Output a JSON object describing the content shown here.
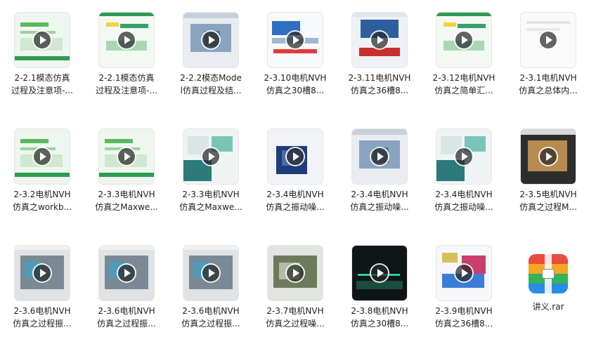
{
  "files": [
    {
      "line1": "2-2.1模态仿真",
      "line2": "过程及注意项-...",
      "theme": "green"
    },
    {
      "line1": "2-2.1模态仿真",
      "line2": "过程及注意项-...",
      "theme": "green2"
    },
    {
      "line1": "2-2.2模态Mode",
      "line2": "l仿真过程及结...",
      "theme": "ui"
    },
    {
      "line1": "2-3.10电机NVH",
      "line2": "仿真之30槽8...",
      "theme": "plot"
    },
    {
      "line1": "2-3.11电机NVH",
      "line2": "仿真之36槽8...",
      "theme": "bluered"
    },
    {
      "line1": "2-3.12电机NVH",
      "line2": "仿真之简单汇...",
      "theme": "green2"
    },
    {
      "line1": "2-3.1电机NVH",
      "line2": "仿真之总体内...",
      "theme": "white"
    },
    {
      "line1": "2-3.2电机NVH",
      "line2": "仿真之workb...",
      "theme": "green"
    },
    {
      "line1": "2-3.3电机NVH",
      "line2": "仿真之Maxwe...",
      "theme": "green"
    },
    {
      "line1": "2-3.3电机NVH",
      "line2": "仿真之Maxwe...",
      "theme": "teal"
    },
    {
      "line1": "2-3.4电机NVH",
      "line2": "仿真之振动噪...",
      "theme": "navy"
    },
    {
      "line1": "2-3.4电机NVH",
      "line2": "仿真之振动噪...",
      "theme": "ui"
    },
    {
      "line1": "2-3.4电机NVH",
      "line2": "仿真之振动噪...",
      "theme": "teal"
    },
    {
      "line1": "2-3.5电机NVH",
      "line2": "仿真之过程M...",
      "theme": "dark"
    },
    {
      "line1": "2-3.6电机NVH",
      "line2": "仿真之过程振...",
      "theme": "gray"
    },
    {
      "line1": "2-3.6电机NVH",
      "line2": "仿真之过程振...",
      "theme": "gray"
    },
    {
      "line1": "2-3.6电机NVH",
      "line2": "仿真之过程振...",
      "theme": "gray"
    },
    {
      "line1": "2-3.7电机NVH",
      "line2": "仿真之过程噪...",
      "theme": "gray2"
    },
    {
      "line1": "2-3.8电机NVH",
      "line2": "仿真之30槽8...",
      "theme": "black"
    },
    {
      "line1": "2-3.9电机NVH",
      "line2": "仿真之36槽8...",
      "theme": "plot2"
    },
    {
      "line1": "讲义.rar",
      "line2": "",
      "theme": "rar"
    }
  ]
}
